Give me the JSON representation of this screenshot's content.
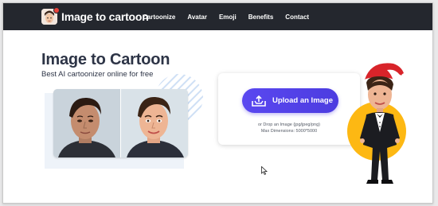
{
  "header": {
    "brand": "Image to cartoon",
    "logo_icon": "cartoon-face-icon",
    "nav": [
      "Cartoonize",
      "Avatar",
      "Emoji",
      "Benefits",
      "Contact"
    ]
  },
  "hero": {
    "title": "Image to Cartoon",
    "subtitle": "Best AI cartoonizer online for free"
  },
  "upload": {
    "button_label": "Upload an Image",
    "button_icon": "upload-tray-icon",
    "drop_text": "or Drop an Image (jpg/jpeg/png)",
    "dimensions_text": "Max Dimensions: 5000*5000"
  },
  "colors": {
    "navbar": "#24272e",
    "accent": "#5a48f0",
    "title": "#2d3446",
    "mascot_circle": "#fdb813"
  }
}
